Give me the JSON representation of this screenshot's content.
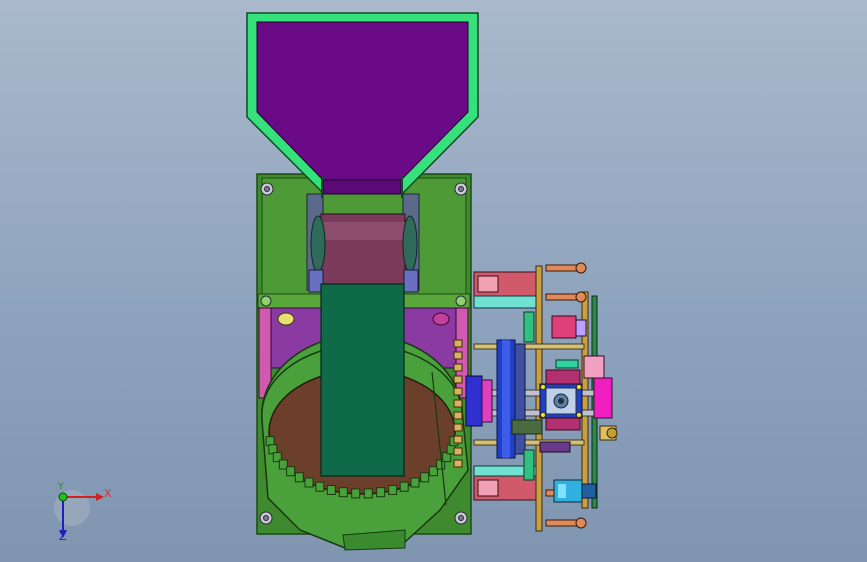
{
  "axes": {
    "x_label": "X",
    "y_label": "Y",
    "z_label": "Z"
  },
  "colors": {
    "background": "#93a7c0",
    "hopper_fill": "#6a0a86",
    "hopper_frame": "#36e07a",
    "plate": "#3f8a2e",
    "plate_edge": "#1e4a12",
    "drum": "#4aa03a",
    "drum_inner": "#6b3f2a",
    "chute": "#0f6a4a",
    "roller": "#7a3a5a",
    "gear_blue": "#2040c8",
    "magenta": "#e020c0",
    "gold": "#c8a040",
    "pink": "#e06aa0"
  }
}
